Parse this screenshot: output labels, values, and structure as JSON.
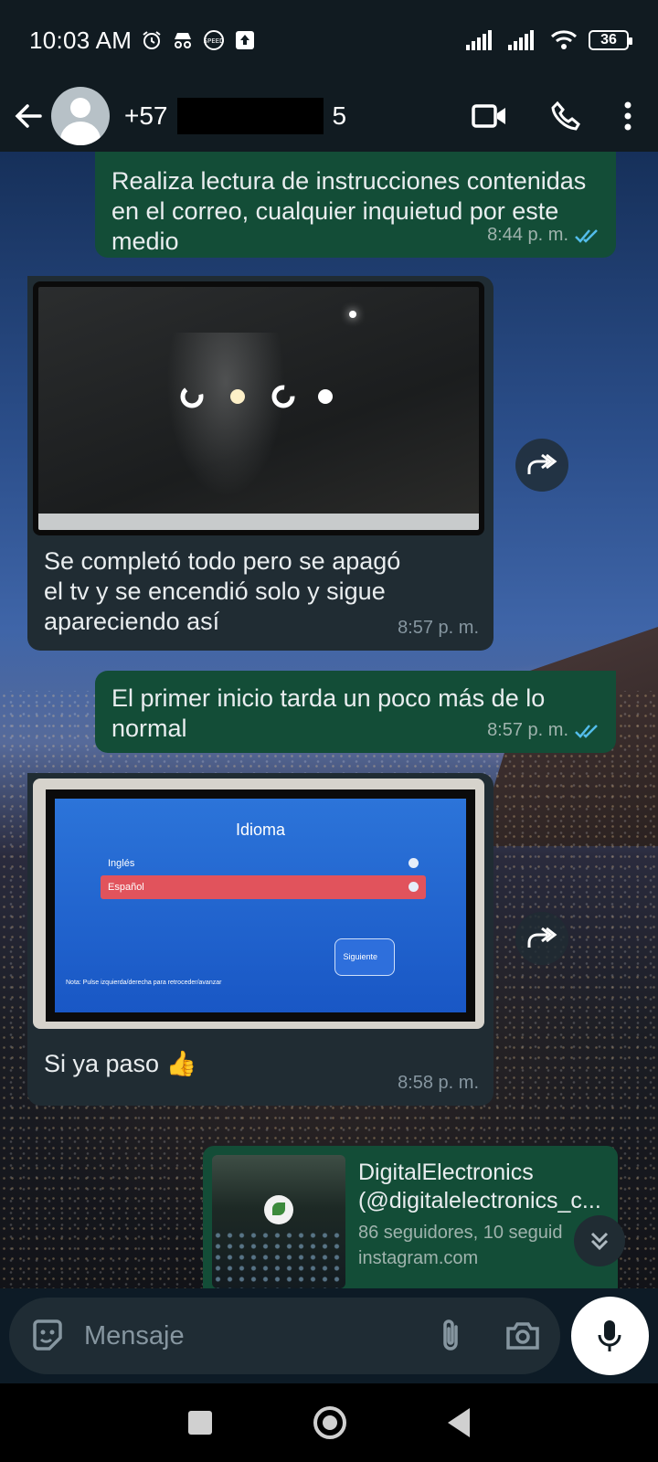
{
  "status_bar": {
    "time": "10:03 AM",
    "battery": "36"
  },
  "header": {
    "contact_prefix": "+57",
    "contact_suffix": "5"
  },
  "messages": [
    {
      "direction": "outgoing",
      "text": "Realiza lectura de instrucciones contenidas en el correo, cualquier inquietud por este medio",
      "time": "8:44 p. m.",
      "status": "read"
    },
    {
      "direction": "incoming",
      "image": "tv-screen-reflection-photo",
      "text": "Se completó todo pero se apagó el tv y se encendió solo y sigue apareciendo así",
      "time": "8:57 p. m."
    },
    {
      "direction": "outgoing",
      "text": "El primer inicio tarda un poco más de lo normal",
      "time": "8:57 p. m.",
      "status": "read"
    },
    {
      "direction": "incoming",
      "image": "tv-language-setup-photo",
      "text": "Si ya paso 👍",
      "time": "8:58 p. m."
    }
  ],
  "tv_screen": {
    "title": "Idioma",
    "options": [
      "Inglés",
      "Español"
    ],
    "button": "Siguiente",
    "note": "Nota: Pulse izquierda/derecha para retroceder/avanzar"
  },
  "link_preview": {
    "title": "DigitalElectronics",
    "handle": "(@digitalelectronics_c...",
    "followers": "86 seguidores, 10 seguid",
    "domain": "instagram.com"
  },
  "input": {
    "placeholder": "Mensaje"
  },
  "colors": {
    "outgoing_bubble": "#134d37",
    "incoming_bubble": "#202c33",
    "read_ticks": "#53bdeb"
  }
}
